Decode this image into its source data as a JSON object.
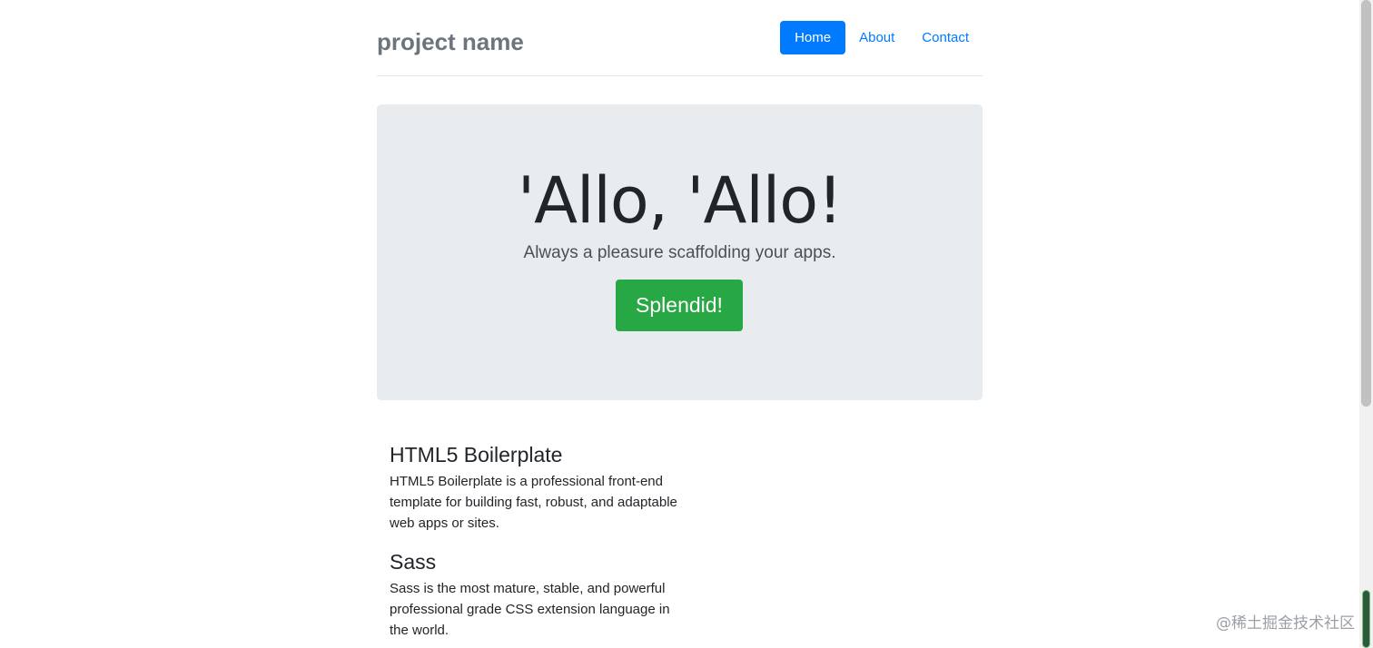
{
  "header": {
    "brand": "project name",
    "nav": [
      {
        "label": "Home",
        "active": true
      },
      {
        "label": "About",
        "active": false
      },
      {
        "label": "Contact",
        "active": false
      }
    ]
  },
  "jumbotron": {
    "title": "'Allo, 'Allo!",
    "lead": "Always a pleasure scaffolding your apps.",
    "button_label": "Splendid!"
  },
  "features": [
    {
      "title": "HTML5 Boilerplate",
      "text": "HTML5 Boilerplate is a professional front-end template for building fast, robust, and adaptable web apps or sites."
    },
    {
      "title": "Sass",
      "text": "Sass is the most mature, stable, and powerful professional grade CSS extension language in the world."
    }
  ],
  "watermark": "@稀土掘金技术社区",
  "colors": {
    "primary": "#007bff",
    "success": "#28a745",
    "jumbotron_bg": "#e9ecef",
    "brand": "#6c757d"
  }
}
